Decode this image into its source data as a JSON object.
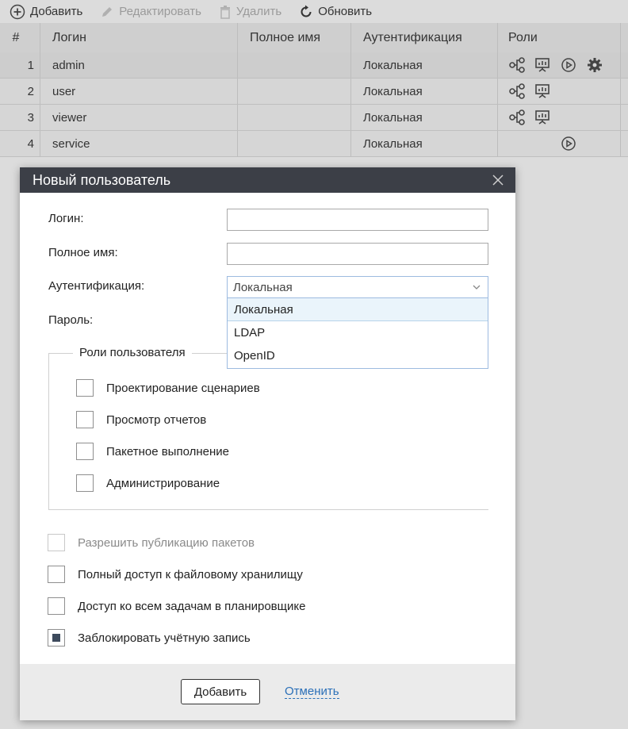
{
  "toolbar": {
    "add": "Добавить",
    "edit": "Редактировать",
    "delete": "Удалить",
    "refresh": "Обновить"
  },
  "table": {
    "columns": [
      "#",
      "Логин",
      "Полное имя",
      "Аутентификация",
      "Роли"
    ],
    "rows": [
      {
        "num": "1",
        "login": "admin",
        "full_name": "",
        "auth": "Локальная",
        "roles": [
          "scenario-design-icon",
          "reports-icon",
          "run-icon",
          "settings-icon"
        ]
      },
      {
        "num": "2",
        "login": "user",
        "full_name": "",
        "auth": "Локальная",
        "roles": [
          "scenario-design-icon",
          "reports-icon"
        ]
      },
      {
        "num": "3",
        "login": "viewer",
        "full_name": "",
        "auth": "Локальная",
        "roles": [
          "scenario-design-icon",
          "reports-icon"
        ]
      },
      {
        "num": "4",
        "login": "service",
        "full_name": "",
        "auth": "Локальная",
        "roles": [
          "run-icon"
        ]
      }
    ]
  },
  "dialog": {
    "title": "Новый пользователь",
    "login_label": "Логин:",
    "login_value": "",
    "fullname_label": "Полное имя:",
    "fullname_value": "",
    "auth_label": "Аутентификация:",
    "auth_selected": "Локальная",
    "auth_options": [
      "Локальная",
      "LDAP",
      "OpenID"
    ],
    "password_label": "Пароль:",
    "roles_legend": "Роли пользователя",
    "roles": [
      {
        "label": "Проектирование сценариев",
        "checked": false
      },
      {
        "label": "Просмотр отчетов",
        "checked": false
      },
      {
        "label": "Пакетное выполнение",
        "checked": false
      },
      {
        "label": "Администрирование",
        "checked": false
      }
    ],
    "options": [
      {
        "label": "Разрешить публикацию пакетов",
        "checked": false,
        "disabled": true
      },
      {
        "label": "Полный доступ к файловому хранилищу",
        "checked": false,
        "disabled": false
      },
      {
        "label": "Доступ ко всем задачам в планировщике",
        "checked": false,
        "disabled": false
      },
      {
        "label": "Заблокировать учётную запись",
        "checked": true,
        "disabled": false
      }
    ],
    "submit": "Добавить",
    "cancel": "Отменить"
  }
}
